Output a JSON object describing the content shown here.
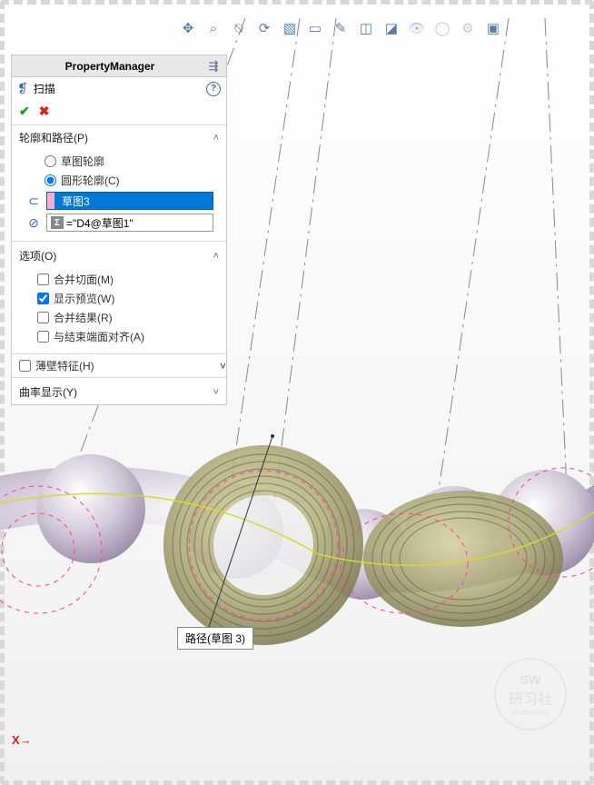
{
  "toolbar": {
    "icons": [
      "move-icon",
      "zoom-fit-icon",
      "zoom-area-icon",
      "rotate-view-icon",
      "section-icon",
      "display-mode-icon",
      "paint-icon",
      "box-icon",
      "box2-icon",
      "eye-icon",
      "globe-icon",
      "settings-icon",
      "monitor-icon"
    ]
  },
  "panel": {
    "title": "PropertyManager",
    "feature_name": "扫描",
    "sections": {
      "profile_path": {
        "title": "轮廓和路径(P)",
        "radio_sketch": "草图轮廓",
        "radio_circle": "圆形轮廓(C)",
        "selection": "草图3",
        "formula": "=\"D4@草图1\""
      },
      "options": {
        "title": "选项(O)",
        "merge_tangent": "合并切面(M)",
        "show_preview": "显示预览(W)",
        "merge_result": "合并结果(R)",
        "align_end": "与结束端面对齐(A)"
      },
      "thin": {
        "title": "薄壁特征(H)"
      },
      "curvature": {
        "title": "曲率显示(Y)"
      }
    }
  },
  "tooltip": "路径(草图 3)",
  "axis": {
    "x": "X"
  },
  "watermark": {
    "line1": "SW",
    "line2": "研习社",
    "line3": "SolidWorks"
  }
}
